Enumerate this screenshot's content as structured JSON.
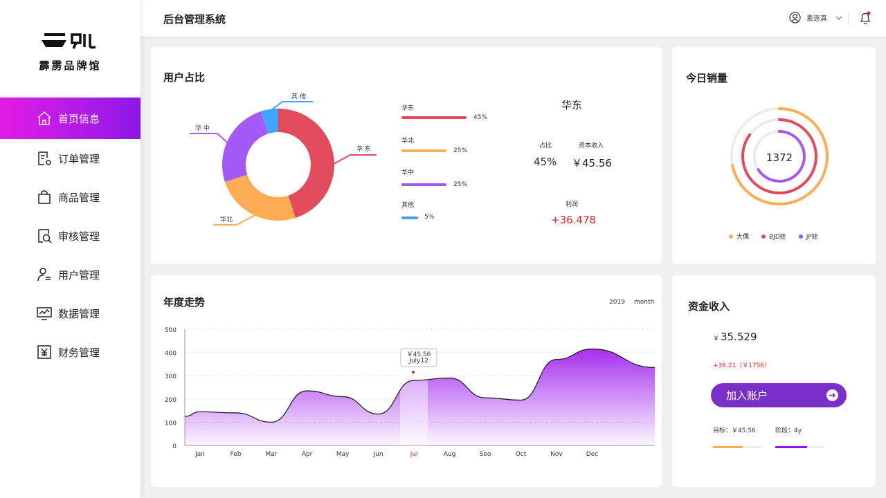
{
  "brand": {
    "name": "霹雳品牌馆"
  },
  "sidebar": {
    "items": [
      {
        "label": "首页信息",
        "icon": "home-icon"
      },
      {
        "label": "订单管理",
        "icon": "order-settings-icon"
      },
      {
        "label": "商品管理",
        "icon": "shopping-bag-icon"
      },
      {
        "label": "审核管理",
        "icon": "review-search-icon"
      },
      {
        "label": "用户管理",
        "icon": "user-list-icon"
      },
      {
        "label": "数据管理",
        "icon": "monitor-chart-icon"
      },
      {
        "label": "财务管理",
        "icon": "yen-icon"
      }
    ]
  },
  "header": {
    "title": "后台管理系统",
    "user_name": "素逐真"
  },
  "colors": {
    "accent": "#8d18e6",
    "accent_start": "#e21de5",
    "red": "#e24b5c",
    "orange": "#ffad55",
    "purple": "#a259f5",
    "blue": "#3fa4ff",
    "profit": "#e62222"
  },
  "user_share": {
    "title": "用户占比",
    "selected": {
      "region": "华东",
      "share_label": "占比",
      "share": "45%",
      "income_label": "资本收入",
      "income": "￥45.56",
      "profit_label": "利润",
      "profit": "+36.478"
    },
    "legend": [
      {
        "label": "华东",
        "value": "45%"
      },
      {
        "label": "华北",
        "value": "25%"
      },
      {
        "label": "华中",
        "value": "25%"
      },
      {
        "label": "其他",
        "value": "5%"
      }
    ],
    "callouts": {
      "east": "华 东",
      "north": "华北",
      "central": "华 中",
      "other": "其 他"
    }
  },
  "daily_sales": {
    "title": "今日销量",
    "total": "1372",
    "legend": [
      "大偶",
      "BJD娃",
      "JP娃"
    ]
  },
  "trend": {
    "title": "年度走势",
    "year": "2019",
    "period": "month",
    "tooltip_value": "￥45.56",
    "tooltip_date": "July12"
  },
  "funds": {
    "title": "资金收入",
    "currency": "￥",
    "amount": "35.529",
    "change": "+36.21（￥1756）",
    "button_label": "加入账户",
    "target_label": "目标：￥45.56",
    "stage_label": "阶段：4y"
  },
  "chart_data": [
    {
      "type": "pie",
      "title": "用户占比",
      "categories": [
        "华东",
        "华北",
        "华中",
        "其他"
      ],
      "values": [
        45,
        25,
        25,
        5
      ]
    },
    {
      "type": "line",
      "title": "年度走势",
      "categories": [
        "Jan",
        "Feb",
        "Mar",
        "Apr",
        "May",
        "Jun",
        "Jul",
        "Aug",
        "Seo",
        "Oct",
        "Nov",
        "Dec"
      ],
      "values": [
        145,
        140,
        100,
        235,
        210,
        135,
        280,
        290,
        205,
        195,
        370,
        415
      ],
      "yticks": [
        "0",
        "100",
        "200",
        "300",
        "400",
        "500"
      ],
      "ylim": [
        0,
        500
      ],
      "highlight": "Jul"
    },
    {
      "type": "pie",
      "title": "今日销量",
      "series": [
        {
          "name": "大偶",
          "value": 0.72
        },
        {
          "name": "BJD娃",
          "value": 0.85
        },
        {
          "name": "JP娃",
          "value": 0.66
        }
      ]
    }
  ]
}
